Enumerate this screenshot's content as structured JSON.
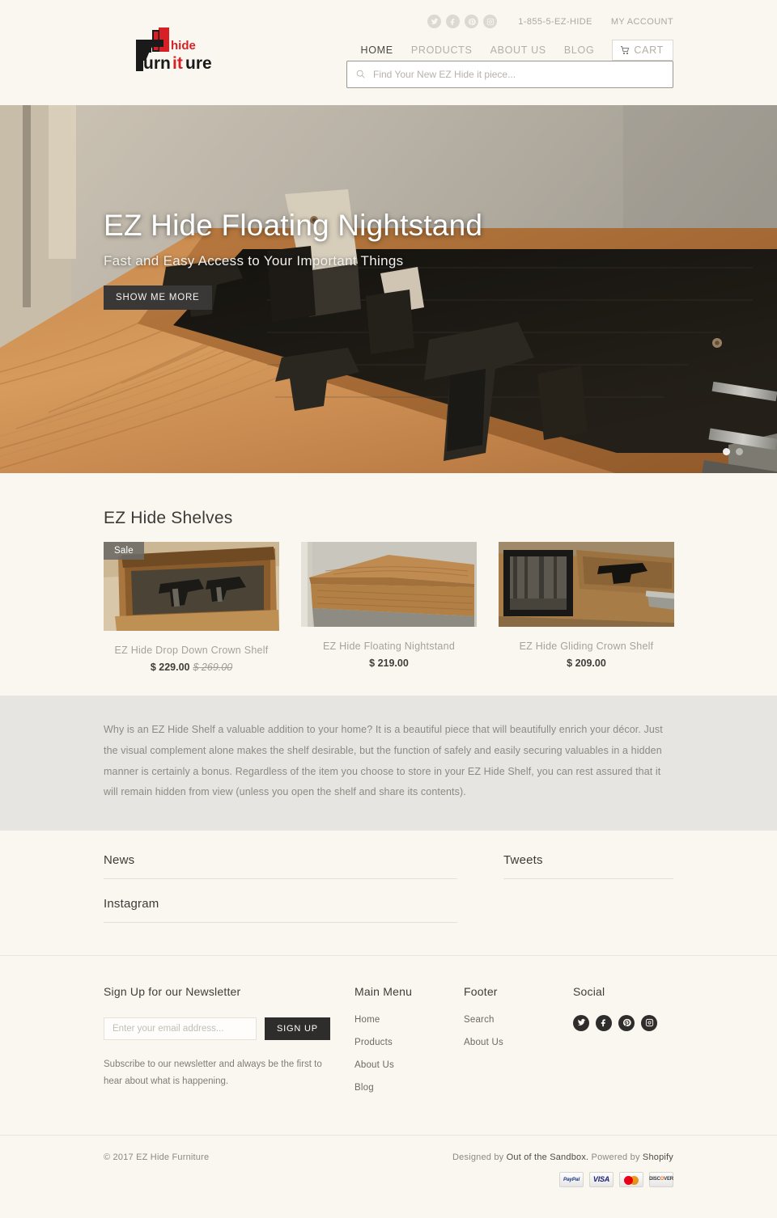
{
  "header": {
    "logo": {
      "word_main": "furniture",
      "word_accent": "hide",
      "alt": "EZ Hide Furniture"
    },
    "social": [
      {
        "name": "twitter-icon",
        "label": "Twitter"
      },
      {
        "name": "facebook-icon",
        "label": "Facebook"
      },
      {
        "name": "pinterest-icon",
        "label": "Pinterest"
      },
      {
        "name": "instagram-icon",
        "label": "Instagram"
      }
    ],
    "phone": "1-855-5-EZ-HIDE",
    "account": "MY ACCOUNT",
    "nav": [
      {
        "label": "HOME",
        "active": true
      },
      {
        "label": "PRODUCTS",
        "active": false
      },
      {
        "label": "ABOUT US",
        "active": false
      },
      {
        "label": "BLOG",
        "active": false
      }
    ],
    "cart_label": "CART",
    "search": {
      "placeholder": "Find Your New EZ Hide it piece...",
      "value": ""
    }
  },
  "hero": {
    "title": "EZ Hide Floating Nightstand",
    "subtitle": "Fast and Easy Access to Your Important Things",
    "button": "SHOW ME MORE",
    "slides_total": 2,
    "active_slide": 1
  },
  "products_section": {
    "title": "EZ Hide Shelves",
    "items": [
      {
        "title": "EZ Hide Drop Down Crown Shelf",
        "price": "$ 229.00",
        "compare_at": "$ 269.00",
        "badge": "Sale"
      },
      {
        "title": "EZ Hide Floating Nightstand",
        "price": "$ 219.00",
        "compare_at": "",
        "badge": ""
      },
      {
        "title": "EZ Hide Gliding Crown Shelf",
        "price": "$ 209.00",
        "compare_at": "",
        "badge": ""
      }
    ]
  },
  "about": {
    "text": "Why is an EZ Hide Shelf a valuable addition to your home? It is a beautiful piece that will beautifully enrich your décor. Just the visual complement alone makes the shelf desirable, but the function of safely and easily securing valuables in a hidden manner is certainly a bonus. Regardless of the item you choose to store in your EZ Hide Shelf, you can rest assured that it will remain hidden from view (unless you open the shelf and share its contents)."
  },
  "feeds": {
    "news_heading": "News",
    "instagram_heading": "Instagram",
    "tweets_heading": "Tweets"
  },
  "footer": {
    "newsletter": {
      "heading": "Sign Up for our Newsletter",
      "placeholder": "Enter your email address...",
      "value": "",
      "button": "SIGN UP",
      "note": "Subscribe to our newsletter and always be the first to hear about what is happening."
    },
    "main_menu": {
      "heading": "Main Menu",
      "links": [
        "Home",
        "Products",
        "About Us",
        "Blog"
      ]
    },
    "footer_menu": {
      "heading": "Footer",
      "links": [
        "Search",
        "About Us"
      ]
    },
    "social": {
      "heading": "Social",
      "items": [
        {
          "name": "twitter-icon",
          "label": "Twitter"
        },
        {
          "name": "facebook-icon",
          "label": "Facebook"
        },
        {
          "name": "pinterest-icon",
          "label": "Pinterest"
        },
        {
          "name": "instagram-icon",
          "label": "Instagram"
        }
      ]
    },
    "copyright": "© 2017 EZ Hide Furniture",
    "credits_prefix": "Designed by ",
    "credits_designer": "Out of the Sandbox.",
    "credits_mid": " Powered by ",
    "credits_platform": "Shopify",
    "payments": [
      "PayPal",
      "VISA",
      "MasterCard",
      "DISCOVER"
    ]
  },
  "colors": {
    "page_bg": "#faf7f1",
    "band_bg": "#e6e5e1",
    "accent_red": "#d81f26",
    "dark": "#2e2d2b",
    "muted": "#a5a299"
  }
}
